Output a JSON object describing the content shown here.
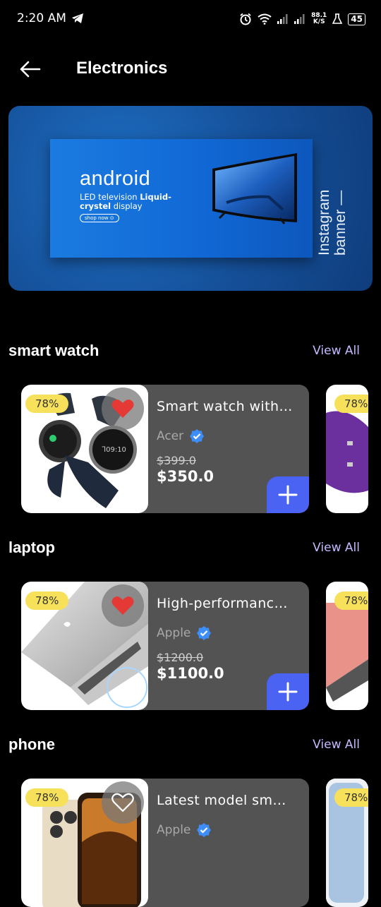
{
  "status": {
    "time": "2:20 AM",
    "net_speed_value": "88.1",
    "net_speed_unit": "K/S",
    "battery": "45"
  },
  "header": {
    "title": "Electronics"
  },
  "banner": {
    "brand": "android",
    "desc_plain": "LED television ",
    "desc_bold1": "Liquid-",
    "desc_bold2": "crystel",
    "desc_end": " display",
    "cta": "shop now",
    "side_text": "Instagram banner —"
  },
  "sections": [
    {
      "title": "smart watch",
      "view_all": "View All",
      "card": {
        "discount": "78%",
        "name": "Smart watch with…",
        "brand": "Acer",
        "old_price": "$399.0",
        "price": "$350.0",
        "favorite": true
      },
      "peek_discount": "78%"
    },
    {
      "title": "laptop",
      "view_all": "View All",
      "card": {
        "discount": "78%",
        "name": "High-performanc…",
        "brand": "Apple",
        "old_price": "$1200.0",
        "price": "$1100.0",
        "favorite": true
      },
      "peek_discount": "78%"
    },
    {
      "title": "phone",
      "view_all": "View All",
      "card": {
        "discount": "78%",
        "name": "Latest model sm…",
        "brand": "Apple",
        "favorite": false
      },
      "peek_discount": "78%"
    }
  ],
  "colors": {
    "accent": "#4a63f2",
    "badge": "#f7e15a",
    "card": "#535353",
    "view_all": "#c7b8ff",
    "heart": "#e53935",
    "verified": "#3d8ef8"
  }
}
